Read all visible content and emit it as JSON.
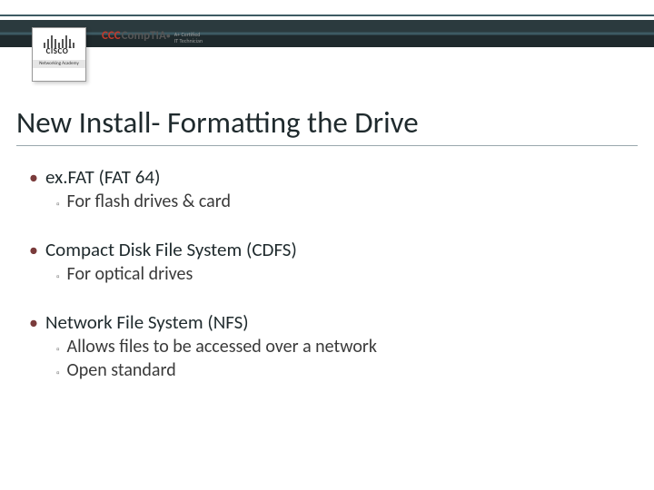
{
  "header": {
    "cisco_label": "CISCO",
    "cisco_tm": "™",
    "cisco_sub": "Networking Academy",
    "comptia_prefix": "CCC",
    "comptia_name": "CompTIA",
    "comptia_dot": "●",
    "comptia_cert_line1": "A+ Certified",
    "comptia_cert_line2": "IT Technician"
  },
  "title": "New Install- Formatting the Drive",
  "items": [
    {
      "label": "ex.FAT (FAT 64)",
      "subs": [
        "For flash drives & card"
      ]
    },
    {
      "label": "Compact Disk File System (CDFS)",
      "subs": [
        "For optical drives"
      ]
    },
    {
      "label": "Network File System (NFS)",
      "subs": [
        "Allows files to be accessed over a network",
        "Open standard"
      ]
    }
  ]
}
